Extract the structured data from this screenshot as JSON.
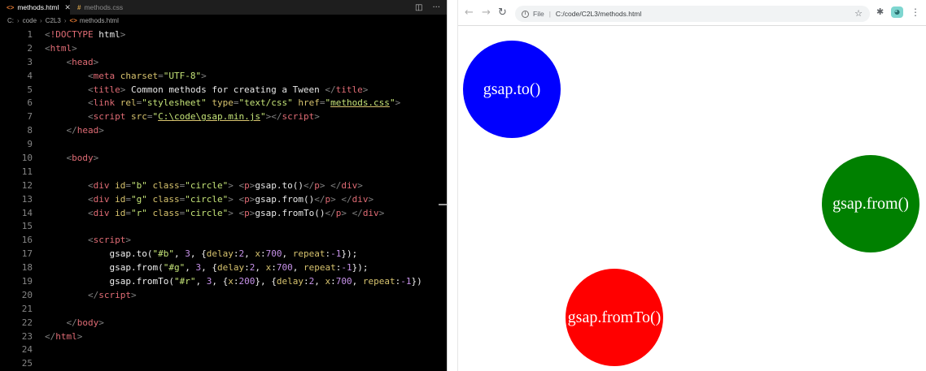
{
  "editor": {
    "tabs": [
      {
        "label": "methods.html",
        "icon": "html-file-icon",
        "active": true
      },
      {
        "label": "methods.css",
        "icon": "css-file-icon",
        "active": false
      }
    ],
    "breadcrumb": [
      "C:",
      "code",
      "C2L3",
      "methods.html"
    ],
    "lines": [
      {
        "n": "1",
        "tokens": [
          [
            "p",
            "<"
          ],
          [
            "tag",
            "!DOCTYPE"
          ],
          [
            "t",
            " html"
          ],
          [
            "p",
            ">"
          ]
        ]
      },
      {
        "n": "2",
        "tokens": [
          [
            "p",
            "<"
          ],
          [
            "tag",
            "html"
          ],
          [
            "p",
            ">"
          ]
        ]
      },
      {
        "n": "3",
        "tokens": [
          [
            "t",
            "    "
          ],
          [
            "p",
            "<"
          ],
          [
            "tag",
            "head"
          ],
          [
            "p",
            ">"
          ]
        ]
      },
      {
        "n": "4",
        "tokens": [
          [
            "t",
            "        "
          ],
          [
            "p",
            "<"
          ],
          [
            "tag",
            "meta"
          ],
          [
            "t",
            " "
          ],
          [
            "attr",
            "charset"
          ],
          [
            "p",
            "="
          ],
          [
            "str",
            "\"UTF-8\""
          ],
          [
            "p",
            ">"
          ]
        ]
      },
      {
        "n": "5",
        "tokens": [
          [
            "t",
            "        "
          ],
          [
            "p",
            "<"
          ],
          [
            "tag",
            "title"
          ],
          [
            "p",
            ">"
          ],
          [
            "t",
            " Common methods for creating a Tween "
          ],
          [
            "p",
            "</"
          ],
          [
            "tag",
            "title"
          ],
          [
            "p",
            ">"
          ]
        ]
      },
      {
        "n": "6",
        "tokens": [
          [
            "t",
            "        "
          ],
          [
            "p",
            "<"
          ],
          [
            "tag",
            "link"
          ],
          [
            "t",
            " "
          ],
          [
            "attr",
            "rel"
          ],
          [
            "p",
            "="
          ],
          [
            "str",
            "\"stylesheet\""
          ],
          [
            "t",
            " "
          ],
          [
            "attr",
            "type"
          ],
          [
            "p",
            "="
          ],
          [
            "str",
            "\"text/css\""
          ],
          [
            "t",
            " "
          ],
          [
            "attr",
            "href"
          ],
          [
            "p",
            "="
          ],
          [
            "str",
            "\""
          ],
          [
            "strlink",
            "methods.css"
          ],
          [
            "str",
            "\""
          ],
          [
            "p",
            ">"
          ]
        ]
      },
      {
        "n": "7",
        "tokens": [
          [
            "t",
            "        "
          ],
          [
            "p",
            "<"
          ],
          [
            "tag",
            "script"
          ],
          [
            "t",
            " "
          ],
          [
            "attr",
            "src"
          ],
          [
            "p",
            "="
          ],
          [
            "str",
            "\""
          ],
          [
            "strlink",
            "C:\\code\\gsap.min.js"
          ],
          [
            "str",
            "\""
          ],
          [
            "p",
            "></"
          ],
          [
            "tag",
            "script"
          ],
          [
            "p",
            ">"
          ]
        ]
      },
      {
        "n": "8",
        "tokens": [
          [
            "t",
            "    "
          ],
          [
            "p",
            "</"
          ],
          [
            "tag",
            "head"
          ],
          [
            "p",
            ">"
          ]
        ]
      },
      {
        "n": "9",
        "tokens": []
      },
      {
        "n": "10",
        "tokens": [
          [
            "t",
            "    "
          ],
          [
            "p",
            "<"
          ],
          [
            "tag",
            "body"
          ],
          [
            "p",
            ">"
          ]
        ]
      },
      {
        "n": "11",
        "tokens": []
      },
      {
        "n": "12",
        "tokens": [
          [
            "t",
            "        "
          ],
          [
            "p",
            "<"
          ],
          [
            "tag",
            "div"
          ],
          [
            "t",
            " "
          ],
          [
            "attr",
            "id"
          ],
          [
            "p",
            "="
          ],
          [
            "str",
            "\"b\""
          ],
          [
            "t",
            " "
          ],
          [
            "attr",
            "class"
          ],
          [
            "p",
            "="
          ],
          [
            "str",
            "\"circle\""
          ],
          [
            "p",
            ">"
          ],
          [
            "t",
            " "
          ],
          [
            "p",
            "<"
          ],
          [
            "tag",
            "p"
          ],
          [
            "p",
            ">"
          ],
          [
            "t",
            "gsap.to()"
          ],
          [
            "p",
            "</"
          ],
          [
            "tag",
            "p"
          ],
          [
            "p",
            ">"
          ],
          [
            "t",
            " "
          ],
          [
            "p",
            "</"
          ],
          [
            "tag",
            "div"
          ],
          [
            "p",
            ">"
          ]
        ]
      },
      {
        "n": "13",
        "tokens": [
          [
            "t",
            "        "
          ],
          [
            "p",
            "<"
          ],
          [
            "tag",
            "div"
          ],
          [
            "t",
            " "
          ],
          [
            "attr",
            "id"
          ],
          [
            "p",
            "="
          ],
          [
            "str",
            "\"g\""
          ],
          [
            "t",
            " "
          ],
          [
            "attr",
            "class"
          ],
          [
            "p",
            "="
          ],
          [
            "str",
            "\"circle\""
          ],
          [
            "p",
            ">"
          ],
          [
            "t",
            " "
          ],
          [
            "p",
            "<"
          ],
          [
            "tag",
            "p"
          ],
          [
            "p",
            ">"
          ],
          [
            "t",
            "gsap.from()"
          ],
          [
            "p",
            "</"
          ],
          [
            "tag",
            "p"
          ],
          [
            "p",
            ">"
          ],
          [
            "t",
            " "
          ],
          [
            "p",
            "</"
          ],
          [
            "tag",
            "div"
          ],
          [
            "p",
            ">"
          ]
        ]
      },
      {
        "n": "14",
        "tokens": [
          [
            "t",
            "        "
          ],
          [
            "p",
            "<"
          ],
          [
            "tag",
            "div"
          ],
          [
            "t",
            " "
          ],
          [
            "attr",
            "id"
          ],
          [
            "p",
            "="
          ],
          [
            "str",
            "\"r\""
          ],
          [
            "t",
            " "
          ],
          [
            "attr",
            "class"
          ],
          [
            "p",
            "="
          ],
          [
            "str",
            "\"circle\""
          ],
          [
            "p",
            ">"
          ],
          [
            "t",
            " "
          ],
          [
            "p",
            "<"
          ],
          [
            "tag",
            "p"
          ],
          [
            "p",
            ">"
          ],
          [
            "t",
            "gsap.fromTo()"
          ],
          [
            "p",
            "</"
          ],
          [
            "tag",
            "p"
          ],
          [
            "p",
            ">"
          ],
          [
            "t",
            " "
          ],
          [
            "p",
            "</"
          ],
          [
            "tag",
            "div"
          ],
          [
            "p",
            ">"
          ]
        ]
      },
      {
        "n": "15",
        "tokens": []
      },
      {
        "n": "16",
        "tokens": [
          [
            "t",
            "        "
          ],
          [
            "p",
            "<"
          ],
          [
            "tag",
            "script"
          ],
          [
            "p",
            ">"
          ]
        ]
      },
      {
        "n": "17",
        "tokens": [
          [
            "t",
            "            "
          ],
          [
            "js",
            "gsap.to("
          ],
          [
            "jstr",
            "\"#b\""
          ],
          [
            "js",
            ", "
          ],
          [
            "num",
            "3"
          ],
          [
            "js",
            ", {"
          ],
          [
            "key",
            "delay"
          ],
          [
            "js",
            ":"
          ],
          [
            "num",
            "2"
          ],
          [
            "js",
            ", "
          ],
          [
            "key",
            "x"
          ],
          [
            "js",
            ":"
          ],
          [
            "num",
            "700"
          ],
          [
            "js",
            ", "
          ],
          [
            "key",
            "repeat"
          ],
          [
            "js",
            ":"
          ],
          [
            "num",
            "-1"
          ],
          [
            "js",
            "});"
          ]
        ]
      },
      {
        "n": "18",
        "tokens": [
          [
            "t",
            "            "
          ],
          [
            "js",
            "gsap.from("
          ],
          [
            "jstr",
            "\"#g\""
          ],
          [
            "js",
            ", "
          ],
          [
            "num",
            "3"
          ],
          [
            "js",
            ", {"
          ],
          [
            "key",
            "delay"
          ],
          [
            "js",
            ":"
          ],
          [
            "num",
            "2"
          ],
          [
            "js",
            ", "
          ],
          [
            "key",
            "x"
          ],
          [
            "js",
            ":"
          ],
          [
            "num",
            "700"
          ],
          [
            "js",
            ", "
          ],
          [
            "key",
            "repeat"
          ],
          [
            "js",
            ":"
          ],
          [
            "num",
            "-1"
          ],
          [
            "js",
            "});"
          ]
        ]
      },
      {
        "n": "19",
        "tokens": [
          [
            "t",
            "            "
          ],
          [
            "js",
            "gsap.fromTo("
          ],
          [
            "jstr",
            "\"#r\""
          ],
          [
            "js",
            ", "
          ],
          [
            "num",
            "3"
          ],
          [
            "js",
            ", {"
          ],
          [
            "key",
            "x"
          ],
          [
            "js",
            ":"
          ],
          [
            "num",
            "200"
          ],
          [
            "js",
            "}, {"
          ],
          [
            "key",
            "delay"
          ],
          [
            "js",
            ":"
          ],
          [
            "num",
            "2"
          ],
          [
            "js",
            ", "
          ],
          [
            "key",
            "x"
          ],
          [
            "js",
            ":"
          ],
          [
            "num",
            "700"
          ],
          [
            "js",
            ", "
          ],
          [
            "key",
            "repeat"
          ],
          [
            "js",
            ":"
          ],
          [
            "num",
            "-1"
          ],
          [
            "js",
            "})"
          ]
        ]
      },
      {
        "n": "20",
        "tokens": [
          [
            "t",
            "        "
          ],
          [
            "p",
            "</"
          ],
          [
            "tag",
            "script"
          ],
          [
            "p",
            ">"
          ]
        ]
      },
      {
        "n": "21",
        "tokens": []
      },
      {
        "n": "22",
        "tokens": [
          [
            "t",
            "    "
          ],
          [
            "p",
            "</"
          ],
          [
            "tag",
            "body"
          ],
          [
            "p",
            ">"
          ]
        ]
      },
      {
        "n": "23",
        "tokens": [
          [
            "p",
            "</"
          ],
          [
            "tag",
            "html"
          ],
          [
            "p",
            ">"
          ]
        ]
      },
      {
        "n": "24",
        "tokens": []
      },
      {
        "n": "25",
        "tokens": []
      }
    ]
  },
  "browser": {
    "omnibox": {
      "scheme": "File",
      "url": "C:/code/C2L3/methods.html"
    },
    "icons": {
      "back": "back-arrow-icon",
      "forward": "forward-arrow-icon",
      "reload": "reload-icon",
      "info": "info-icon",
      "star": "star-icon",
      "extensions": "puzzle-icon",
      "profile": "profile-icon",
      "menu": "kebab-menu-icon"
    },
    "circles": [
      {
        "id": "b",
        "label": "gsap.to()",
        "color": "#0000ff"
      },
      {
        "id": "g",
        "label": "gsap.from()",
        "color": "#008000"
      },
      {
        "id": "r",
        "label": "gsap.fromTo()",
        "color": "#ff0000"
      }
    ]
  }
}
